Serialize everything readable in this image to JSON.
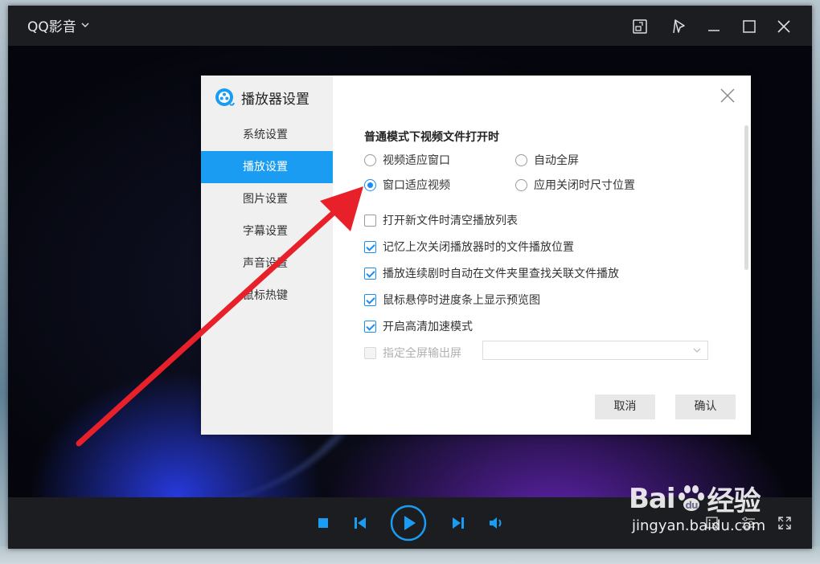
{
  "app": {
    "title": "QQ影音",
    "menu_icon": "chevron-down-icon"
  },
  "titlebar_icons": [
    "mini-mode-icon",
    "pin-icon",
    "minimize-icon",
    "maximize-icon",
    "close-icon"
  ],
  "dialog": {
    "title": "播放器设置",
    "nav": [
      {
        "label": "系统设置",
        "active": false
      },
      {
        "label": "播放设置",
        "active": true
      },
      {
        "label": "图片设置",
        "active": false
      },
      {
        "label": "字幕设置",
        "active": false
      },
      {
        "label": "声音设置",
        "active": false
      },
      {
        "label": "鼠标热键",
        "active": false
      }
    ],
    "section_title": "普通模式下视频文件打开时",
    "radios": [
      {
        "label": "视频适应窗口",
        "selected": false
      },
      {
        "label": "自动全屏",
        "selected": false
      },
      {
        "label": "窗口适应视频",
        "selected": true
      },
      {
        "label": "应用关闭时尺寸位置",
        "selected": false
      }
    ],
    "checks": [
      {
        "label": "打开新文件时清空播放列表",
        "checked": false
      },
      {
        "label": "记忆上次关闭播放器时的文件播放位置",
        "checked": true
      },
      {
        "label": "播放连续剧时自动在文件夹里查找关联文件播放",
        "checked": true
      },
      {
        "label": "鼠标悬停时进度条上显示预览图",
        "checked": true
      },
      {
        "label": "开启高清加速模式",
        "checked": true
      }
    ],
    "fullscreen_output": {
      "label": "指定全屏输出屏",
      "checked": false,
      "disabled": true,
      "value": ""
    },
    "cancel_label": "取消",
    "ok_label": "确认"
  },
  "controls": [
    "stop-icon",
    "previous-icon",
    "play-icon",
    "next-icon",
    "volume-icon"
  ],
  "watermark": {
    "brand_left": "Bai",
    "brand_right": "经验",
    "url": "jingyan.baidu.com"
  },
  "colors": {
    "accent": "#1a9cf2",
    "annotation_arrow": "#e8202a"
  }
}
